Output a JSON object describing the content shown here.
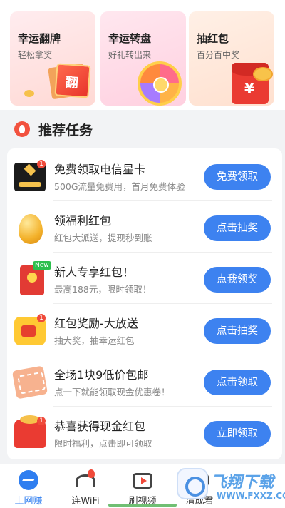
{
  "promos": [
    {
      "title": "幸运翻牌",
      "subtitle": "轻松拿奖"
    },
    {
      "title": "幸运转盘",
      "subtitle": "好礼转出来"
    },
    {
      "title": "抽红包",
      "subtitle": "百分百中奖",
      "symbol": "¥"
    }
  ],
  "section": {
    "title": "推荐任务"
  },
  "tasks": [
    {
      "icon": "vip-card-icon",
      "badge": "1",
      "title": "免费领取电信星卡",
      "subtitle": "500G流量免费用，首月免费体验",
      "button": "免费领取"
    },
    {
      "icon": "golden-egg-icon",
      "title": "领福利红包",
      "subtitle": "红包大派送，提现秒到账",
      "button": "点击抽奖"
    },
    {
      "icon": "red-envelope-icon",
      "tag": "New",
      "title": "新人专享红包！",
      "subtitle": "最高188元，限时领取！",
      "button": "点我领奖"
    },
    {
      "icon": "lucky-envelope-icon",
      "badge": "1",
      "title": "红包奖励-大放送",
      "subtitle": "抽大奖，抽幸运红包",
      "button": "点击抽奖"
    },
    {
      "icon": "coupon-icon",
      "title": "全场1块9低价包邮",
      "subtitle": "点一下就能领取现金优惠卷！",
      "button": "点击领取"
    },
    {
      "icon": "gift-icon",
      "badge": "1",
      "title": "恭喜获得现金红包",
      "subtitle": "限时福利，点击即可领取",
      "button": "立即领取"
    }
  ],
  "tabs": [
    {
      "label": "上网赚",
      "active": true
    },
    {
      "label": "连WiFi",
      "active": false
    },
    {
      "label": "刷视频",
      "active": false
    },
    {
      "label": "清成君",
      "active": false
    }
  ],
  "watermark": {
    "title": "飞翔下载",
    "url": "WWW.FXXZ.COM"
  },
  "colors": {
    "accent": "#3d82f0",
    "badge": "#f04a3a",
    "background": "#f2f3f5"
  }
}
